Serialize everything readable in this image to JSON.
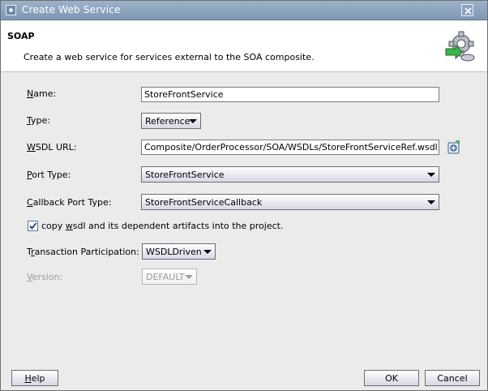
{
  "window": {
    "title": "Create Web Service"
  },
  "header": {
    "title": "SOAP",
    "description": "Create a web service for services external to the SOA composite."
  },
  "form": {
    "name": {
      "label_key": "N",
      "label_rest": "ame:",
      "value": "StoreFrontService"
    },
    "type": {
      "label_key": "T",
      "label_rest": "ype:",
      "value": "Reference"
    },
    "wsdl_url": {
      "label_key": "W",
      "label_rest": "SDL URL:",
      "value": "Composite/OrderProcessor/SOA/WSDLs/StoreFrontServiceRef.wsdl"
    },
    "port_type": {
      "label_key": "P",
      "label_rest": "ort Type:",
      "value": "StoreFrontService"
    },
    "callback_port_type": {
      "label_key": "C",
      "label_rest": "allback Port Type:",
      "value": "StoreFrontServiceCallback"
    },
    "copy_wsdl": {
      "checked": true,
      "label_pre": "copy ",
      "label_key": "w",
      "label_rest": "sdl and its dependent artifacts into the project."
    },
    "transaction": {
      "label_pre": "T",
      "label_key": "r",
      "label_rest": "ansaction Participation:",
      "value": "WSDLDriven"
    },
    "version": {
      "label_key": "V",
      "label_rest": "ersion:",
      "value": "DEFAULT"
    }
  },
  "buttons": {
    "help": {
      "label_key": "H",
      "label_rest": "elp"
    },
    "ok": {
      "label": "OK"
    },
    "cancel": {
      "label": "Cancel"
    }
  },
  "colors": {
    "titlebar": "#8aa2bd",
    "header_bg": "#ffffff",
    "dialog_bg": "#ebebeb"
  }
}
